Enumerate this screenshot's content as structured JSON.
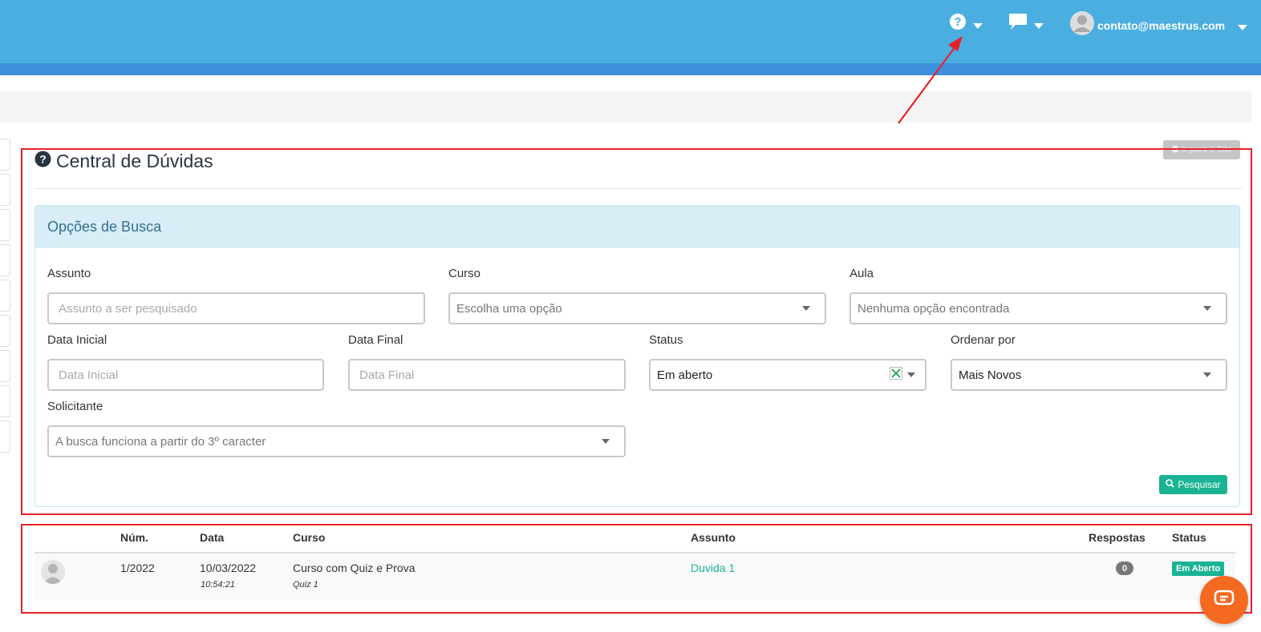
{
  "header": {
    "user_email": "contato@maestrus.com",
    "brand_color": "#4aaee0",
    "accent_color": "#1ab394"
  },
  "page": {
    "title": "Central de Dúvidas",
    "site_button_label": "Ir para o Site"
  },
  "search_panel": {
    "heading": "Opções de Busca",
    "assunto": {
      "label": "Assunto",
      "placeholder": "Assunto a ser pesquisado"
    },
    "curso": {
      "label": "Curso",
      "value": "Escolha uma opção"
    },
    "aula": {
      "label": "Aula",
      "value": "Nenhuma opção encontrada"
    },
    "data_inicial": {
      "label": "Data Inicial",
      "placeholder": "Data Inicial"
    },
    "data_final": {
      "label": "Data Final",
      "placeholder": "Data Final"
    },
    "status": {
      "label": "Status",
      "value": "Em aberto"
    },
    "ordenar": {
      "label": "Ordenar por",
      "value": "Mais Novos"
    },
    "solicitante": {
      "label": "Solicitante",
      "value": "A busca funciona a partir do 3º caracter"
    },
    "search_button": "Pesquisar"
  },
  "table": {
    "headers": {
      "num": "Núm.",
      "data": "Data",
      "curso": "Curso",
      "assunto": "Assunto",
      "respostas": "Respostas",
      "status": "Status"
    },
    "rows": [
      {
        "num": "1/2022",
        "date": "10/03/2022",
        "time": "10:54:21",
        "course": "Curso com Quiz e Prova",
        "lesson": "Quiz 1",
        "subject": "Duvida 1",
        "answers": "0",
        "status": "Em Aberto"
      }
    ]
  }
}
